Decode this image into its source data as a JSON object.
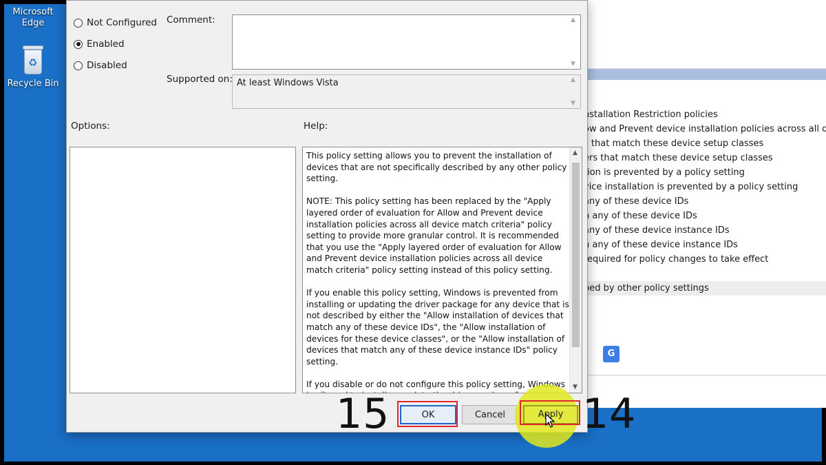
{
  "desktop": {
    "icons": [
      {
        "label": "Microsoft Edge",
        "label_line1": "Microsoft",
        "label_line2": "Edge"
      },
      {
        "label": "Recycle Bin"
      }
    ]
  },
  "background_window": {
    "list_items": [
      "nstallation Restriction policies",
      "ow and Prevent device installation policies across all device",
      "s that match these device setup classes",
      "ers that match these device setup classes",
      "tion is prevented by a policy setting",
      "vice installation is prevented by a policy setting",
      "any of these device IDs",
      "h any of these device IDs",
      "any of these device instance IDs",
      "h any of these device instance IDs",
      "required for policy changes to take effect",
      "s",
      "bed by other policy settings"
    ]
  },
  "dialog": {
    "radio_not_configured": "Not Configured",
    "radio_enabled": "Enabled",
    "radio_disabled": "Disabled",
    "selected": "Enabled",
    "comment_label": "Comment:",
    "comment_value": "",
    "supported_label": "Supported on:",
    "supported_value": "At least Windows Vista",
    "options_label": "Options:",
    "help_label": "Help:",
    "help_paragraphs": [
      "This policy setting allows you to prevent the installation of devices that are not specifically described by any other policy setting.",
      "NOTE: This policy setting has been replaced by the \"Apply layered order of evaluation for Allow and Prevent device installation policies across all device match criteria\" policy setting to provide more granular control. It is recommended that you use the \"Apply layered order of evaluation for Allow and Prevent device installation policies across all device match criteria\" policy setting instead of this policy setting.",
      "If you enable this policy setting, Windows is prevented from installing or updating the driver package for any device that is not described by either the \"Allow installation of devices that match any of these device IDs\", the \"Allow installation of devices for these device classes\", or the \"Allow installation of devices that match any of these device instance IDs\" policy setting.",
      "If you disable or do not configure this policy setting, Windows is allowed to install or update the driver package for any device"
    ],
    "ok_label": "OK",
    "cancel_label": "Cancel",
    "apply_label": "Apply"
  },
  "annotations": {
    "step_ok": "15",
    "step_apply": "14",
    "frame_color": "#e0262b",
    "highlight_color": "#e1e81e"
  }
}
